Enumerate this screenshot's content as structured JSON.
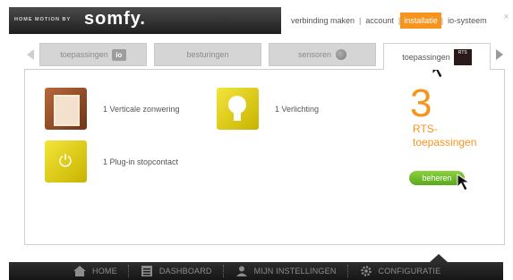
{
  "header": {
    "brand_tagline": "HOME MOTION BY",
    "brand_name": "somfy.",
    "nav": [
      "verbinding maken",
      "account",
      "installatie",
      "io-systeem"
    ],
    "active_nav": "installatie",
    "close_label": "×"
  },
  "tabs": [
    {
      "label": "toepassingen",
      "badge": "io"
    },
    {
      "label": "besturingen"
    },
    {
      "label": "sensoren"
    },
    {
      "label": "toepassingen",
      "badge": "RTS",
      "active": true
    }
  ],
  "products": [
    {
      "label": "1 Verticale zonwering",
      "icon": "vertical-blind-icon"
    },
    {
      "label": "1 Verlichting",
      "icon": "light-bulb-icon"
    },
    {
      "label": "1 Plug-in stopcontact",
      "icon": "plug-socket-icon"
    }
  ],
  "summary": {
    "count": "3",
    "label_line1": "RTS-",
    "label_line2": "toepassingen",
    "manage_button": "beheren"
  },
  "bottom_nav": [
    {
      "label": "HOME",
      "icon": "home-icon"
    },
    {
      "label": "DASHBOARD",
      "icon": "dashboard-icon"
    },
    {
      "label": "MIJN INSTELLINGEN",
      "icon": "user-icon"
    },
    {
      "label": "CONFIGURATIE",
      "icon": "gear-icon"
    }
  ],
  "colors": {
    "accent": "#f7941d",
    "button_green": "#6cbd2a"
  }
}
